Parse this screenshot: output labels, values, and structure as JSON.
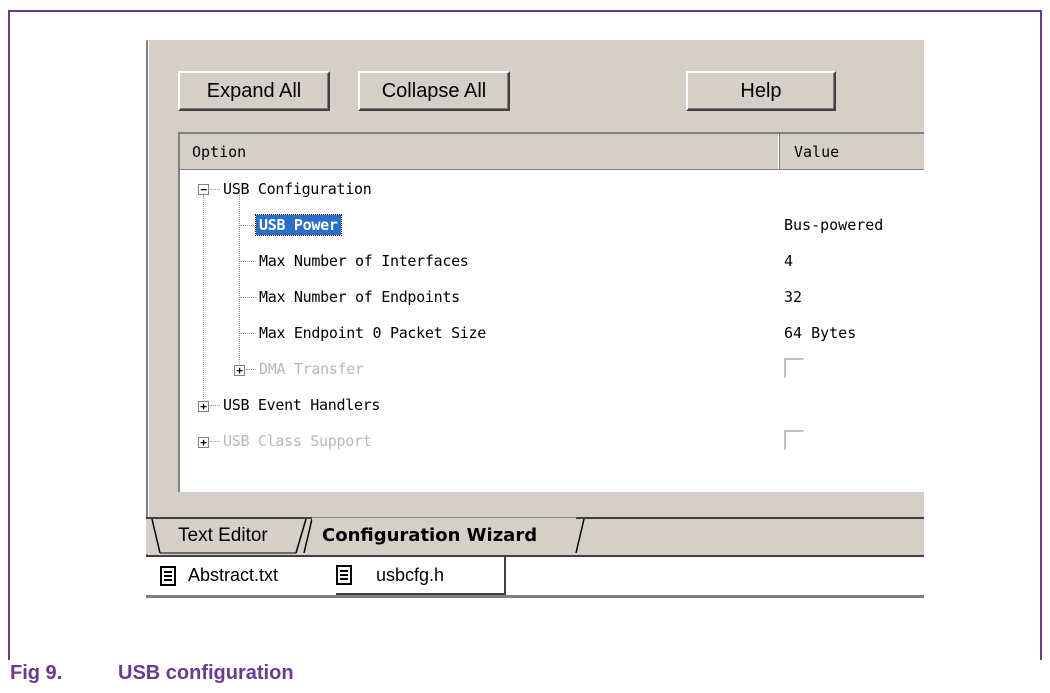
{
  "toolbar": {
    "expand_all": "Expand All",
    "collapse_all": "Collapse All",
    "help": "Help"
  },
  "tree": {
    "columns": {
      "option": "Option",
      "value": "Value"
    },
    "rows": [
      {
        "label": "USB Configuration",
        "value": "",
        "expander": "−",
        "disabled": false
      },
      {
        "label": "USB Power",
        "value": "Bus-powered",
        "selected": true
      },
      {
        "label": "Max Number of Interfaces",
        "value": "4"
      },
      {
        "label": "Max Number of Endpoints",
        "value": "32"
      },
      {
        "label": "Max Endpoint 0 Packet Size",
        "value": "64 Bytes"
      },
      {
        "label": "DMA Transfer",
        "value": "",
        "expander": "+",
        "disabled": true,
        "checkbox": false
      },
      {
        "label": "USB Event Handlers",
        "value": "",
        "expander": "+"
      },
      {
        "label": "USB Class Support",
        "value": "",
        "expander": "+",
        "disabled": true,
        "checkbox": false
      }
    ]
  },
  "tabs": [
    {
      "label": "Text Editor",
      "active": false
    },
    {
      "label": "Configuration Wizard",
      "active": true
    }
  ],
  "files": [
    {
      "name": "Abstract.txt",
      "icon": "text-file-icon"
    },
    {
      "name": "usbcfg.h",
      "icon": "text-file-icon"
    }
  ],
  "caption": {
    "number": "Fig 9.",
    "title": "USB configuration"
  },
  "colors": {
    "frame": "#6b3a8c",
    "selection": "#2a6ec8",
    "window_bg": "#d4d0c8"
  }
}
